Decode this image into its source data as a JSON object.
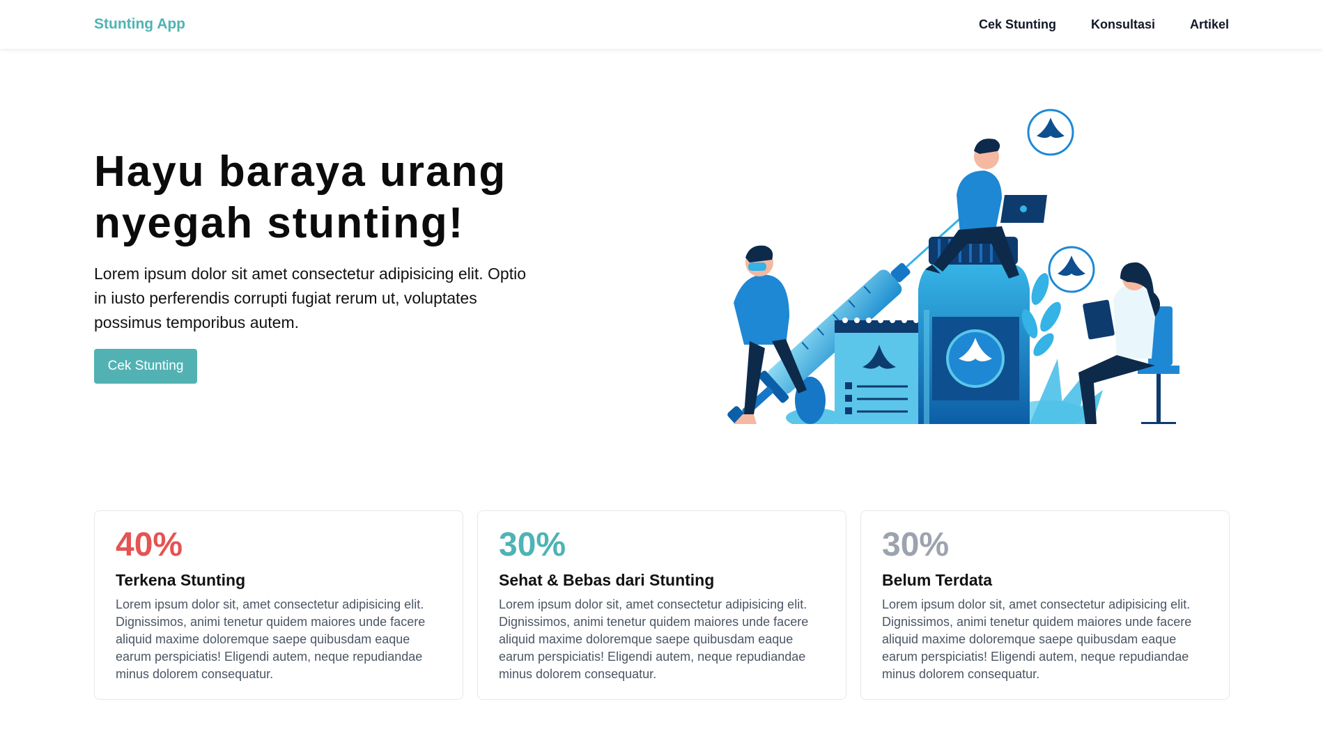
{
  "navbar": {
    "brand": "Stunting App",
    "links": [
      "Cek Stunting",
      "Konsultasi",
      "Artikel"
    ]
  },
  "hero": {
    "title": "Hayu baraya urang nyegah stunting!",
    "text": "Lorem ipsum dolor sit amet consectetur adipisicing elit. Optio in iusto perferendis corrupti fugiat rerum ut, voluptates possimus temporibus autem.",
    "button_label": "Cek Stunting"
  },
  "stats": [
    {
      "value": "40%",
      "title": "Terkena Stunting",
      "text": "Lorem ipsum dolor sit, amet consectetur adipisicing elit. Dignissimos, animi tenetur quidem maiores unde facere aliquid maxime doloremque saepe quibusdam eaque earum perspiciatis! Eligendi autem, neque repudiandae minus dolorem consequatur.",
      "color": "#e55353"
    },
    {
      "value": "30%",
      "title": "Sehat & Bebas dari Stunting",
      "text": "Lorem ipsum dolor sit, amet consectetur adipisicing elit. Dignissimos, animi tenetur quidem maiores unde facere aliquid maxime doloremque saepe quibusdam eaque earum perspiciatis! Eligendi autem, neque repudiandae minus dolorem consequatur.",
      "color": "#4eb3b4"
    },
    {
      "value": "30%",
      "title": "Belum Terdata",
      "text": "Lorem ipsum dolor sit, amet consectetur adipisicing elit. Dignissimos, animi tenetur quidem maiores unde facere aliquid maxime doloremque saepe quibusdam eaque earum perspiciatis! Eligendi autem, neque repudiandae minus dolorem consequatur.",
      "color": "#9ca3af"
    }
  ],
  "colors": {
    "accent": "#52b2b3",
    "brand": "#4eb3b4"
  }
}
